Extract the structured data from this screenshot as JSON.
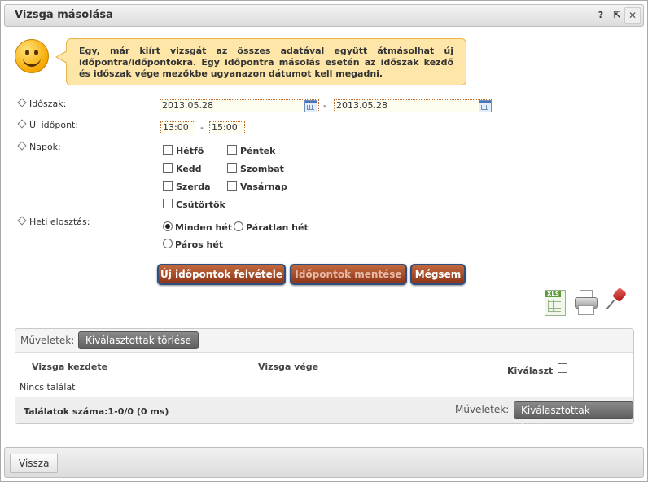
{
  "window": {
    "title": "Vizsga másolása",
    "help_label": "?",
    "popout_label": "⇱",
    "close_label": "✕"
  },
  "info": {
    "text": "Egy, már kiírt vizsgát az összes adatával együtt átmásolhat új időpontra/időpontokra. Egy időpontra másolás esetén az időszak kezdő és időszak vége mezőkbe ugyanazon dátumot kell megadni."
  },
  "form": {
    "period_label": "Időszak:",
    "period_from": "2013.05.28",
    "period_sep": "-",
    "period_to": "2013.05.28",
    "new_time_label": "Új időpont:",
    "time_from": "13:00",
    "time_sep": "-",
    "time_to": "15:00",
    "days_label": "Napok:",
    "days": [
      "Hétfő",
      "Kedd",
      "Szerda",
      "Csütörtök",
      "Péntek",
      "Szombat",
      "Vasárnap"
    ],
    "weekly_label": "Heti elosztás:",
    "weekly_options": [
      "Minden hét",
      "Páratlan hét",
      "Páros hét"
    ],
    "weekly_selected": "Minden hét"
  },
  "buttons": {
    "add_times": "Új időpontok felvétele",
    "save_times": "Időpontok mentése",
    "cancel": "Mégsem"
  },
  "grid": {
    "ops_label": "Műveletek:",
    "delete_selected": "Kiválasztottak törlése",
    "columns": {
      "start": "Vizsga kezdete",
      "end": "Vizsga vége",
      "select": "Kiválaszt"
    },
    "empty_text": "Nincs találat",
    "count_text": "Találatok száma:1-0/0 (0 ms)"
  },
  "footer": {
    "back_label": "Vissza"
  },
  "icons": [
    "excel-export-icon",
    "print-icon",
    "pin-icon"
  ]
}
